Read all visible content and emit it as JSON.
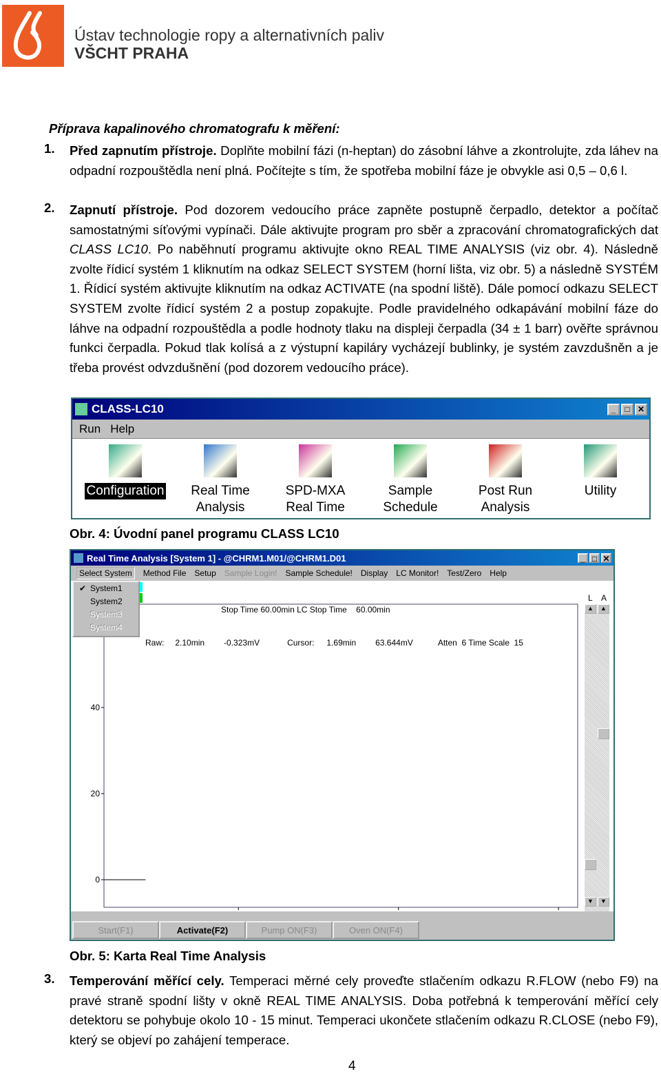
{
  "header": {
    "institute": "Ústav technologie ropy a alternativních paliv",
    "school": "VŠCHT PRAHA",
    "brand_color": "#ec5b24"
  },
  "heading": "Příprava kapalinového chromatografu k měření:",
  "items": [
    {
      "num": "1.",
      "title": "Před zapnutím přístroje.",
      "text": " Doplňte mobilní fázi (n-heptan) do zásobní láhve a zkontrolujte, zda láhev na odpadní rozpouštědla není plná. Počítejte s tím, že spotřeba mobilní fáze je obvykle asi 0,5 – 0,6 l."
    },
    {
      "num": "2.",
      "title": "Zapnutí přístroje.",
      "text_a": " Pod dozorem vedoucího práce zapněte postupně čerpadlo, detektor a počítač samostatnými síťovými vypínači. Dále aktivujte program pro sběr a zpracování chromatografických dat ",
      "italic": "CLASS LC10",
      "text_b": ". Po naběhnutí programu aktivujte okno REAL TIME ANALYSIS (viz obr. 4). Následně zvolte řídicí systém 1 kliknutím na odkaz SELECT SYSTEM (horní lišta, viz obr. 5) a následně SYSTÉM 1. Řídicí systém aktivujte kliknutím na odkaz ACTIVATE (na spodní liště). Dále pomocí odkazu SELECT SYSTEM zvolte řídicí systém 2 a postup zopakujte. Podle pravidelného odkapávání mobilní fáze do láhve na odpadní rozpouštědla a podle hodnoty tlaku na displeji čerpadla (34 ± 1 barr) ověřte správnou funkci čerpadla. Pokud tlak kolísá a z výstupní kapiláry vycházejí bublinky, je systém zavzdušněn a je třeba provést odvzdušnění (pod dozorem vedoucího práce)."
    },
    {
      "num": "3.",
      "title": "Temperování měřící cely.",
      "text": " Temperaci měrné cely proveďte stlačením odkazu R.FLOW (nebo F9) na pravé straně spodní lišty v okně REAL TIME ANALYSIS. Doba potřebná k temperování měřící cely detektoru se pohybuje okolo 10 - 15 minut. Temperaci ukončete stlačením odkazu R.CLOSE (nebo F9), který se objeví po zahájení temperace."
    }
  ],
  "fig4": {
    "title": "CLASS-LC10",
    "menu": [
      "Run",
      "Help"
    ],
    "icons": [
      {
        "label1": "Configuration",
        "label2": "",
        "icon": "computer-config-icon"
      },
      {
        "label1": "Real Time",
        "label2": "Analysis",
        "icon": "chromatogram-timer-icon"
      },
      {
        "label1": "SPD-MXA",
        "label2": "Real Time",
        "icon": "spectrum-timer-icon"
      },
      {
        "label1": "Sample",
        "label2": "Schedule",
        "icon": "schedule-flask-icon"
      },
      {
        "label1": "Post Run",
        "label2": "Analysis",
        "icon": "post-run-icon"
      },
      {
        "label1": "Utility",
        "label2": "",
        "icon": "utility-icon"
      }
    ],
    "caption": "Obr. 4: Úvodní panel programu CLASS LC10"
  },
  "fig5": {
    "title": "Real Time Analysis [System 1] - @CHRM1.M01/@CHRM1.D01",
    "menu": [
      {
        "label": "Select System",
        "disabled": false
      },
      {
        "label": "Method File",
        "disabled": false
      },
      {
        "label": "Setup",
        "disabled": false
      },
      {
        "label": "Sample Login!",
        "disabled": true
      },
      {
        "label": "Sample Schedule!",
        "disabled": false
      },
      {
        "label": "Display",
        "disabled": false
      },
      {
        "label": "LC Monitor!",
        "disabled": false
      },
      {
        "label": "Test/Zero",
        "disabled": false
      },
      {
        "label": "Help",
        "disabled": false
      }
    ],
    "dropdown": [
      {
        "label": "System1",
        "checked": true,
        "disabled": false
      },
      {
        "label": "System2",
        "checked": false,
        "disabled": false
      },
      {
        "label": "System3",
        "checked": false,
        "disabled": true
      },
      {
        "label": "System4",
        "checked": false,
        "disabled": true
      }
    ],
    "status": {
      "stop_time_label": "Stop Time",
      "stop_time": "60.00min",
      "lc_stop_label": "LC Stop Time",
      "lc_stop": "60.00min",
      "raw_label": "Raw:",
      "raw_time": "2.10min",
      "raw_mv": "-0.323mV",
      "cursor_label": "Cursor:",
      "cursor_time": "1.69min",
      "cursor_mv": "63.644mV",
      "atten": "Atten  6 Time Scale  15",
      "l": "L",
      "a": "A"
    },
    "chart_data": {
      "type": "line",
      "x": [
        0.8,
        2.1
      ],
      "y": [
        0,
        0
      ],
      "xticks": [
        "5",
        "10",
        "15"
      ],
      "yticks": [
        "0",
        "20",
        "40"
      ],
      "xlim": [
        0.8,
        15.6
      ],
      "ylim": [
        -6.4,
        64
      ],
      "grid": false,
      "line_color": "#000000"
    },
    "buttons": [
      {
        "label": "Start(F1)",
        "disabled": true
      },
      {
        "label": "Activate(F2)",
        "disabled": false
      },
      {
        "label": "Pump ON(F3)",
        "disabled": true
      },
      {
        "label": "Oven ON(F4)",
        "disabled": true
      }
    ],
    "caption": "Obr. 5: Karta Real Time Analysis"
  },
  "page_number": "4"
}
